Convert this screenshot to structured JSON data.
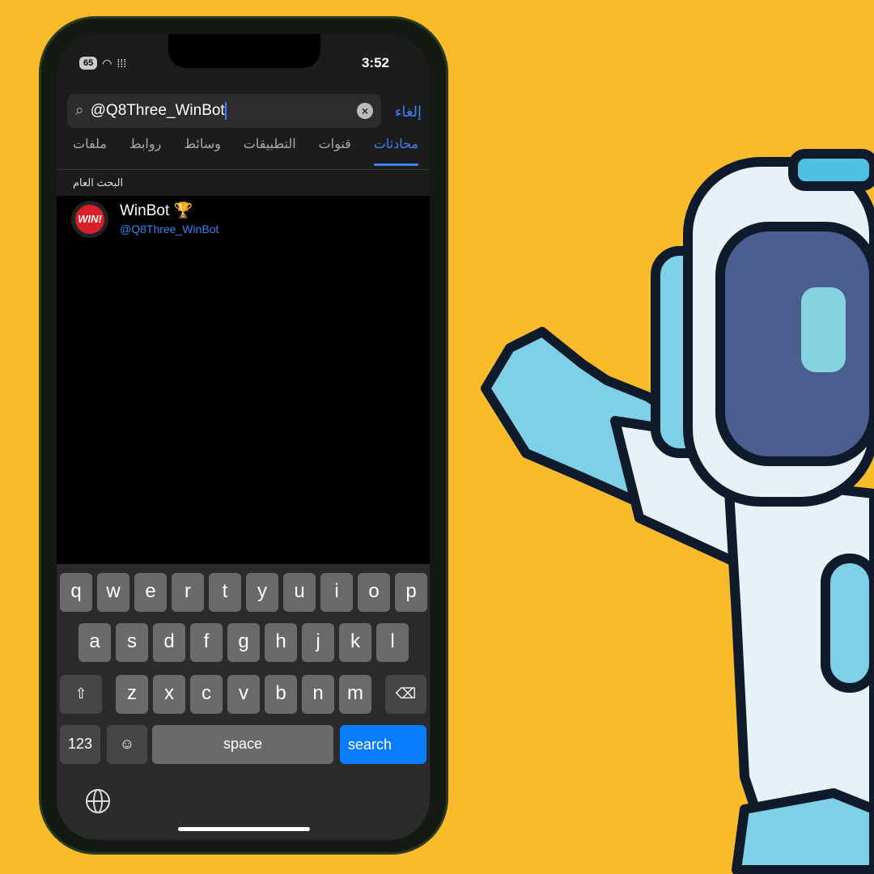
{
  "status": {
    "battery": "65",
    "time": "3:52"
  },
  "search": {
    "value": "@Q8Three_WinBot",
    "cancel": "إلغاء"
  },
  "tabs": [
    {
      "label": "محادثات",
      "active": true
    },
    {
      "label": "قنوات"
    },
    {
      "label": "التطبيقات"
    },
    {
      "label": "وسائط"
    },
    {
      "label": "روابط"
    },
    {
      "label": "ملفات"
    }
  ],
  "section": "البحث العام",
  "result": {
    "name": "WinBot 🏆",
    "username": "@Q8Three_WinBot",
    "avatar_text": "WIN!"
  },
  "keyboard": {
    "row1": [
      "q",
      "w",
      "e",
      "r",
      "t",
      "y",
      "u",
      "i",
      "o",
      "p"
    ],
    "row2": [
      "a",
      "s",
      "d",
      "f",
      "g",
      "h",
      "j",
      "k",
      "l"
    ],
    "row3": [
      "z",
      "x",
      "c",
      "v",
      "b",
      "n",
      "m"
    ],
    "numbers": "123",
    "space": "space",
    "search": "search"
  },
  "colors": {
    "background": "#F9BB2A",
    "accent": "#3b82f6",
    "search_key": "#0a7cff"
  }
}
